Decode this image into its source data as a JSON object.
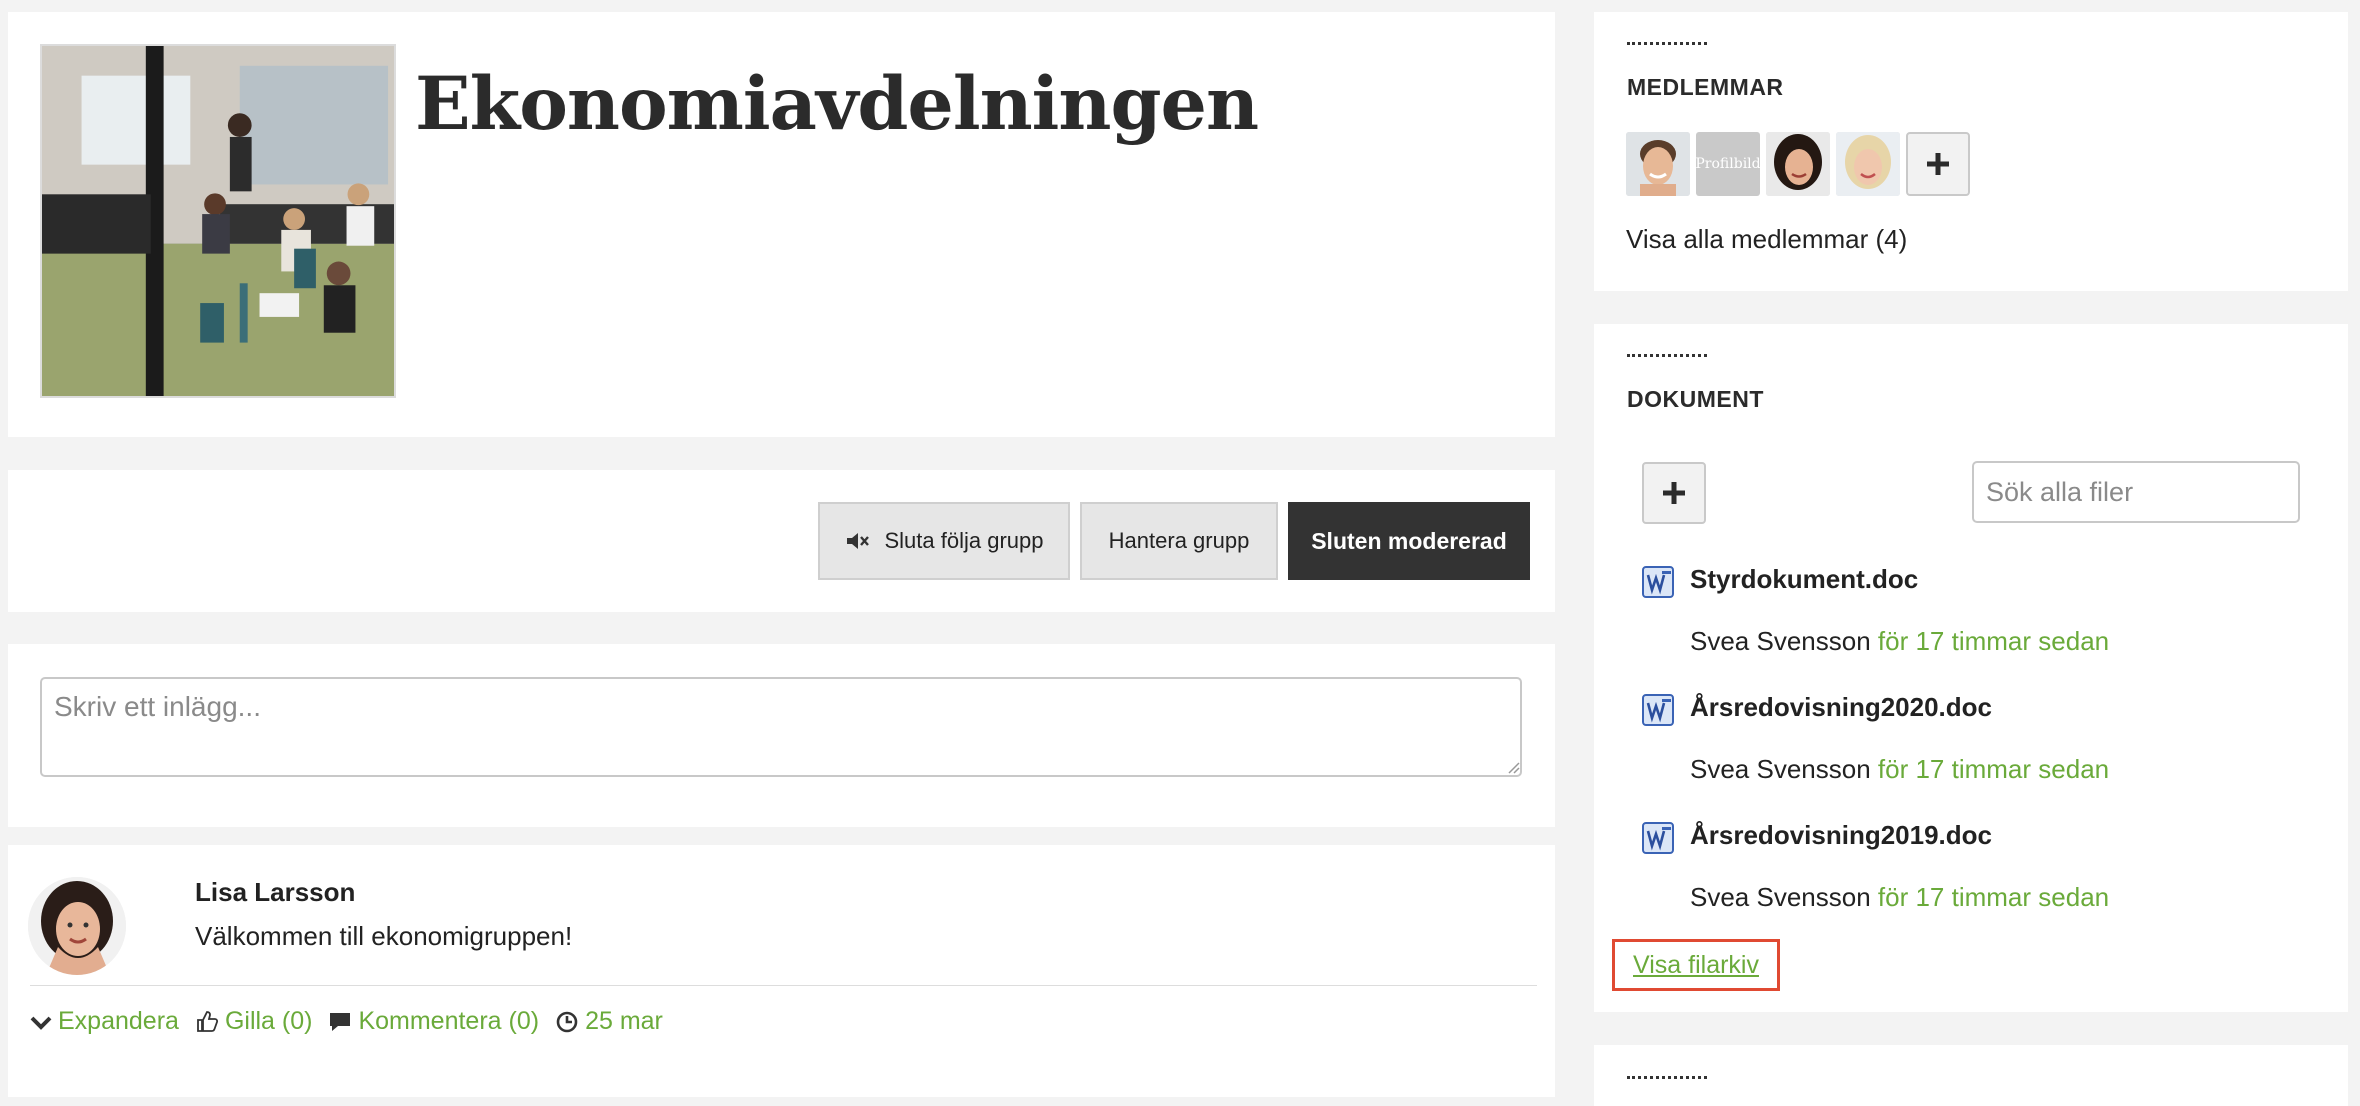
{
  "group": {
    "title": "Ekonomiavdelningen"
  },
  "actions": {
    "unfollow_label": "Sluta följa grupp",
    "manage_label": "Hantera grupp",
    "status_label": "Sluten modererad"
  },
  "composer": {
    "placeholder": "Skriv ett inlägg..."
  },
  "post": {
    "author": "Lisa Larsson",
    "text": "Välkommen till ekonomigruppen!",
    "expand_label": "Expandera",
    "like_label": "Gilla (0)",
    "comment_label": "Kommentera (0)",
    "date": "25 mar"
  },
  "members": {
    "heading": "MEDLEMMAR",
    "placeholder_avatar_text": "Profilbild",
    "show_all_label": "Visa alla medlemmar (4)"
  },
  "documents": {
    "heading": "DOKUMENT",
    "search_placeholder": "Sök alla filer",
    "files": [
      {
        "name": "Styrdokument.doc",
        "author": "Svea Svensson",
        "time": "för 17 timmar sedan"
      },
      {
        "name": "Årsredovisning2020.doc",
        "author": "Svea Svensson",
        "time": "för 17 timmar sedan"
      },
      {
        "name": "Årsredovisning2019.doc",
        "author": "Svea Svensson",
        "time": "för 17 timmar sedan"
      }
    ],
    "archive_link": "Visa filarkiv"
  },
  "colors": {
    "accent_green": "#6aaa3a",
    "dark_button": "#333333",
    "highlight_red": "#e04a32"
  }
}
